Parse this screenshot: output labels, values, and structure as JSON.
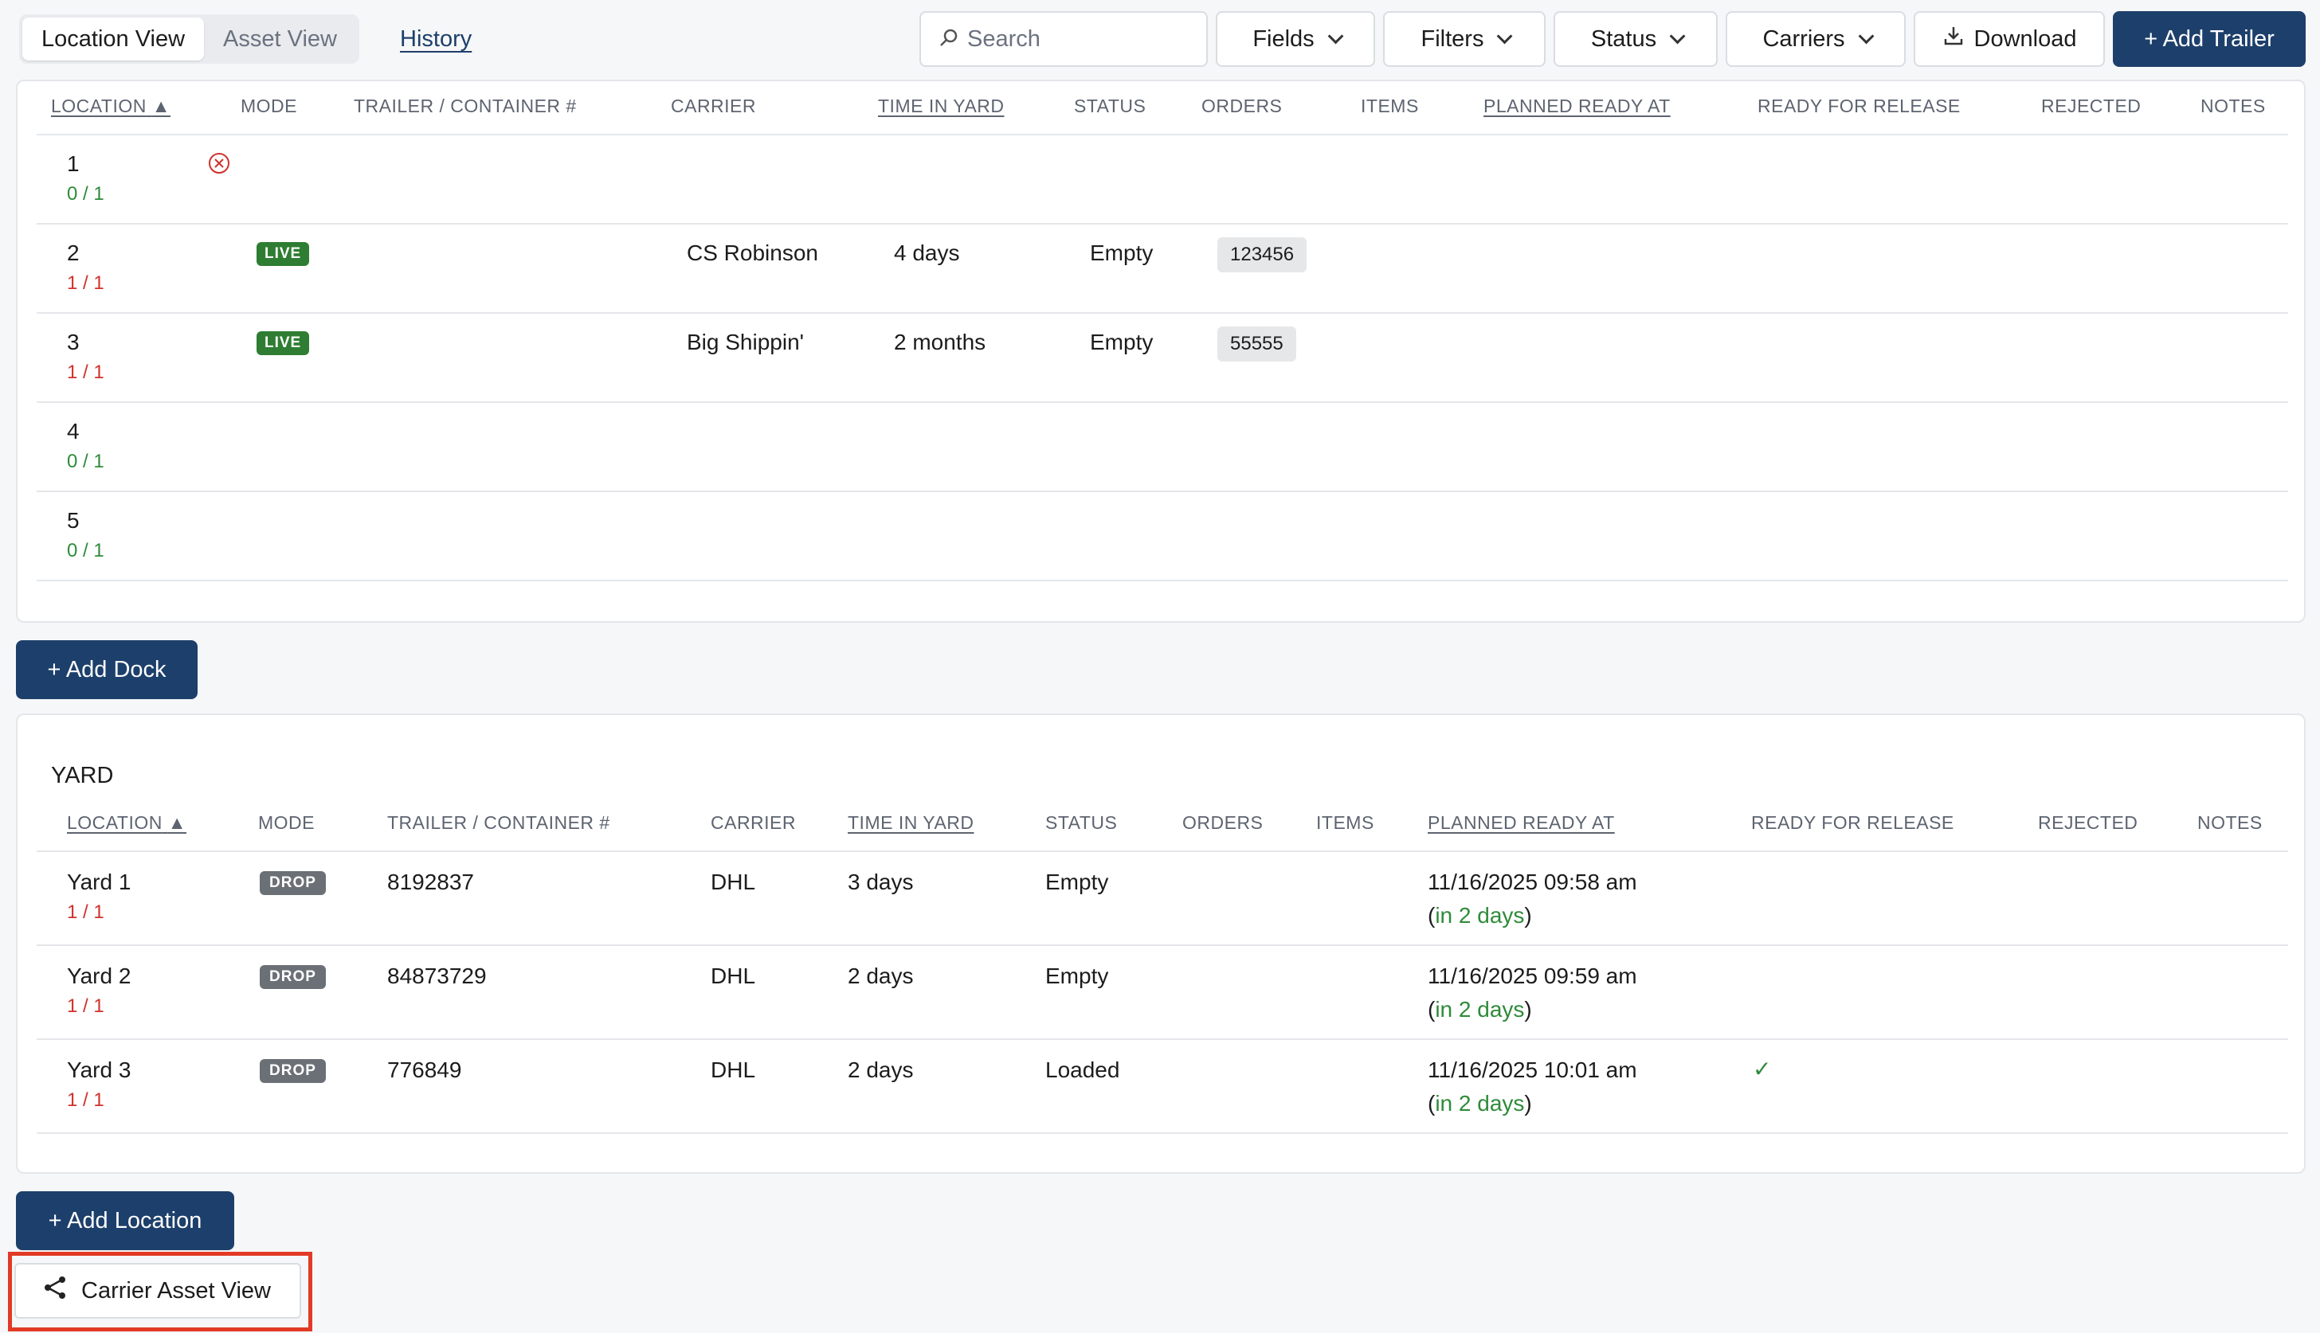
{
  "toolbar": {
    "tabs": [
      {
        "label": "Location View",
        "active": true
      },
      {
        "label": "Asset View",
        "active": false
      }
    ],
    "history_label": "History",
    "search_placeholder": "Search",
    "fields_label": "Fields",
    "filters_label": "Filters",
    "status_label": "Status",
    "carriers_label": "Carriers",
    "download_label": "Download",
    "add_trailer_label": "+ Add Trailer"
  },
  "dock_table": {
    "headers": {
      "location": "LOCATION",
      "mode": "MODE",
      "trailer": "TRAILER / CONTAINER #",
      "carrier": "CARRIER",
      "time": "TIME IN YARD",
      "status": "STATUS",
      "orders": "ORDERS",
      "items": "ITEMS",
      "planned": "PLANNED READY AT",
      "ready": "READY FOR RELEASE",
      "rejected": "REJECTED",
      "notes": "NOTES"
    },
    "rows": [
      {
        "location": "1",
        "occupancy": "0 / 1",
        "mode": "",
        "carrier": "",
        "time": "",
        "status": "",
        "order": ""
      },
      {
        "location": "2",
        "occupancy": "1 / 1",
        "mode": "LIVE",
        "carrier": "CS Robinson",
        "time": "4 days",
        "status": "Empty",
        "order": "123456"
      },
      {
        "location": "3",
        "occupancy": "1 / 1",
        "mode": "LIVE",
        "carrier": "Big Shippin'",
        "time": "2 months",
        "status": "Empty",
        "order": "55555"
      },
      {
        "location": "4",
        "occupancy": "0 / 1",
        "mode": "",
        "carrier": "",
        "time": "",
        "status": "",
        "order": ""
      },
      {
        "location": "5",
        "occupancy": "0 / 1",
        "mode": "",
        "carrier": "",
        "time": "",
        "status": "",
        "order": ""
      }
    ]
  },
  "add_dock_label": "+ Add Dock",
  "yard": {
    "title": "YARD",
    "headers": {
      "location": "LOCATION",
      "mode": "MODE",
      "trailer": "TRAILER / CONTAINER #",
      "carrier": "CARRIER",
      "time": "TIME IN YARD",
      "status": "STATUS",
      "orders": "ORDERS",
      "items": "ITEMS",
      "planned": "PLANNED READY AT",
      "ready": "READY FOR RELEASE",
      "rejected": "REJECTED",
      "notes": "NOTES"
    },
    "rows": [
      {
        "location": "Yard 1",
        "occupancy": "1 / 1",
        "mode": "DROP",
        "trailer": "8192837",
        "carrier": "DHL",
        "time": "3 days",
        "status": "Empty",
        "planned": "11/16/2025 09:58 am",
        "planned_rel": "in 2 days",
        "ready": ""
      },
      {
        "location": "Yard 2",
        "occupancy": "1 / 1",
        "mode": "DROP",
        "trailer": "84873729",
        "carrier": "DHL",
        "time": "2 days",
        "status": "Empty",
        "planned": "11/16/2025 09:59 am",
        "planned_rel": "in 2 days",
        "ready": ""
      },
      {
        "location": "Yard 3",
        "occupancy": "1 / 1",
        "mode": "DROP",
        "trailer": "776849",
        "carrier": "DHL",
        "time": "2 days",
        "status": "Loaded",
        "planned": "11/16/2025 10:01 am",
        "planned_rel": "in 2 days",
        "ready": "✓"
      }
    ]
  },
  "add_location_label": "+ Add Location",
  "carrier_asset_view_label": "Carrier Asset View",
  "colors": {
    "primary": "#1d3f6b",
    "live": "#2e7d32",
    "drop": "#6b7076",
    "ok": "#2e8b3a",
    "full": "#d0312d",
    "highlight": "#e23a26"
  }
}
